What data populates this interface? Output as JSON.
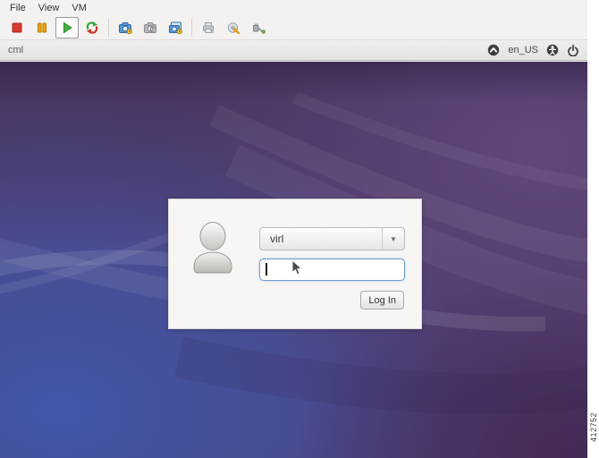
{
  "window": {
    "menu": [
      "File",
      "View",
      "VM"
    ],
    "toolbar_icons": [
      {
        "name": "stop"
      },
      {
        "name": "suspend"
      },
      {
        "name": "play",
        "active": true
      },
      {
        "name": "reset"
      },
      {
        "name": "take-snapshot"
      },
      {
        "name": "revert-snapshot"
      },
      {
        "name": "manage-snapshots"
      },
      {
        "name": "print"
      },
      {
        "name": "settings"
      },
      {
        "name": "usb-device"
      }
    ]
  },
  "guest_panel": {
    "title": "cml",
    "locale": "en_US",
    "icons": [
      "session-icon",
      "accessibility-icon",
      "power-icon"
    ]
  },
  "login": {
    "username": "virl",
    "password_value": "",
    "button_label": "Log In"
  },
  "figure_number": "412752",
  "colors": {
    "desktop_blue": "#4355a3",
    "desktop_purple": "#55406f",
    "focus_border": "#6e9fd4",
    "stop_red": "#d93b30",
    "pause_amber": "#eda50e",
    "play_green": "#44b244",
    "panel_bg": "#e9e7e4"
  }
}
